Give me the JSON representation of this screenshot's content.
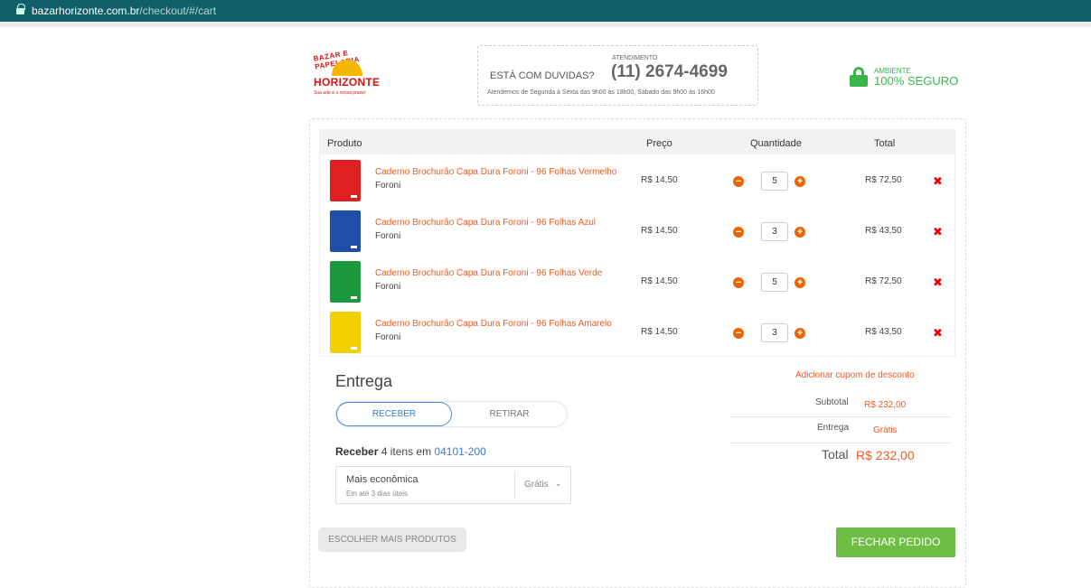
{
  "browser": {
    "host": "bazarhorizonte.com.br",
    "path": "/checkout/#/cart"
  },
  "header": {
    "logo": {
      "arc_text": "BAZAR E PAPELARIA",
      "brand": "HORIZONTE",
      "slogan": "Sua arte é o nosso prazer"
    },
    "help": {
      "question": "ESTÁ COM DUVIDAS?",
      "label": "ATENDIMENTO",
      "phone": "(11) 2674-4699",
      "hours": "Atendemos de Segunda à Sexta das 9h00 às 18h00, Sábado das 9h00 às 16h00"
    },
    "secure": {
      "line1": "AMBIENTE",
      "line2": "100% SEGURO"
    }
  },
  "cart": {
    "headers": {
      "product": "Produto",
      "price": "Preço",
      "quantity": "Quantidade",
      "total": "Total"
    },
    "items": [
      {
        "name": "Caderno Brochurão Capa Dura Foroni - 96 Folhas Vermelho",
        "brand": "Foroni",
        "price": "R$ 14,50",
        "qty": "5",
        "total": "R$ 72,50",
        "color": "#e02020"
      },
      {
        "name": "Caderno Brochurão Capa Dura Foroni - 96 Folhas Azul",
        "brand": "Foroni",
        "price": "R$ 14,50",
        "qty": "3",
        "total": "R$ 43,50",
        "color": "#1f4fa8"
      },
      {
        "name": "Caderno Brochurão Capa Dura Foroni - 96 Folhas Verde",
        "brand": "Foroni",
        "price": "R$ 14,50",
        "qty": "5",
        "total": "R$ 72,50",
        "color": "#1a9a3a"
      },
      {
        "name": "Caderno Brochurão Capa Dura Foroni - 96 Folhas Amarelo",
        "brand": "Foroni",
        "price": "R$ 14,50",
        "qty": "3",
        "total": "R$ 43,50",
        "color": "#f5d000"
      }
    ]
  },
  "delivery": {
    "title": "Entrega",
    "tab_receive": "RECEBER",
    "tab_pickup": "RETIRAR",
    "receive_label": "Receber",
    "receive_text": "4 itens em",
    "cep": "04101-200",
    "option_name": "Mais econômica",
    "option_days": "Em até 3 dias úteis",
    "option_price": "Grátis"
  },
  "summary": {
    "coupon": "Adicionar cupom de desconto",
    "subtotal_label": "Subtotal",
    "subtotal_value": "R$ 232,00",
    "delivery_label": "Entrega",
    "delivery_value": "Grátis",
    "total_label": "Total",
    "total_value": "R$ 232,00"
  },
  "actions": {
    "more_products": "ESCOLHER MAIS PRODUTOS",
    "checkout": "FECHAR PEDIDO"
  },
  "colors": {
    "accent": "#f05a1e",
    "button_green": "#6fbe44",
    "secure_green": "#3bb54a",
    "link_blue": "#3a7bd5"
  }
}
